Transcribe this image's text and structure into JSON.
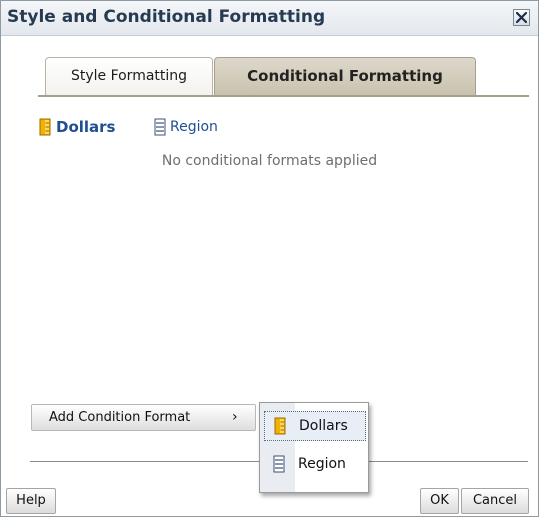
{
  "dialog": {
    "title": "Style and Conditional Formatting",
    "close_icon": "close-icon"
  },
  "tabs": [
    {
      "label": "Style Formatting",
      "selected": false
    },
    {
      "label": "Conditional Formatting",
      "selected": true
    }
  ],
  "columns": [
    {
      "label": "Dollars",
      "icon": "measure-column-icon",
      "bold": true
    },
    {
      "label": "Region",
      "icon": "attribute-column-icon",
      "bold": false
    }
  ],
  "empty_message": "No conditional formats applied",
  "add_button": {
    "label": "Add Condition Format",
    "chevron": "›"
  },
  "popup_menu": {
    "items": [
      {
        "label": "Dollars",
        "icon": "measure-column-icon",
        "hover": true
      },
      {
        "label": "Region",
        "icon": "attribute-column-icon",
        "hover": false
      }
    ]
  },
  "footer": {
    "help": "Help",
    "ok": "OK",
    "cancel": "Cancel"
  },
  "colors": {
    "title_text": "#263a52",
    "link_text": "#1f4f93",
    "selected_tab": "#c9c2ae",
    "measure_icon": "#f2b100",
    "attribute_icon": "#5a6f9e"
  }
}
